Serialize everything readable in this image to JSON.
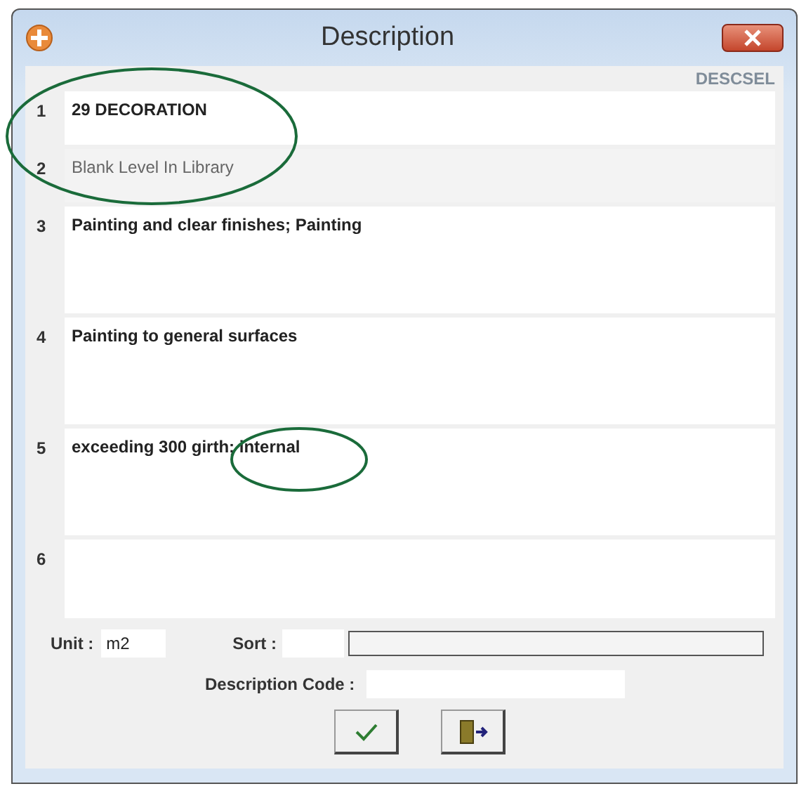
{
  "window": {
    "title": "Description",
    "form_code": "DESCSEL"
  },
  "rows": [
    {
      "number": "1",
      "text": "29 DECORATION",
      "greyed": false,
      "kind": "short"
    },
    {
      "number": "2",
      "text": "Blank Level In Library",
      "greyed": true,
      "kind": "short"
    },
    {
      "number": "3",
      "text": "Painting and clear finishes; Painting",
      "greyed": false,
      "kind": "tall"
    },
    {
      "number": "4",
      "text": "Painting to general surfaces",
      "greyed": false,
      "kind": "tall"
    },
    {
      "number": "5",
      "text": "exceeding 300 girth; internal",
      "greyed": false,
      "kind": "tall"
    },
    {
      "number": "6",
      "text": "",
      "greyed": false,
      "kind": "mid"
    }
  ],
  "unit": {
    "label": "Unit :",
    "value": "m2"
  },
  "sort": {
    "label": "Sort :"
  },
  "description_code": {
    "label": "Description Code :"
  }
}
